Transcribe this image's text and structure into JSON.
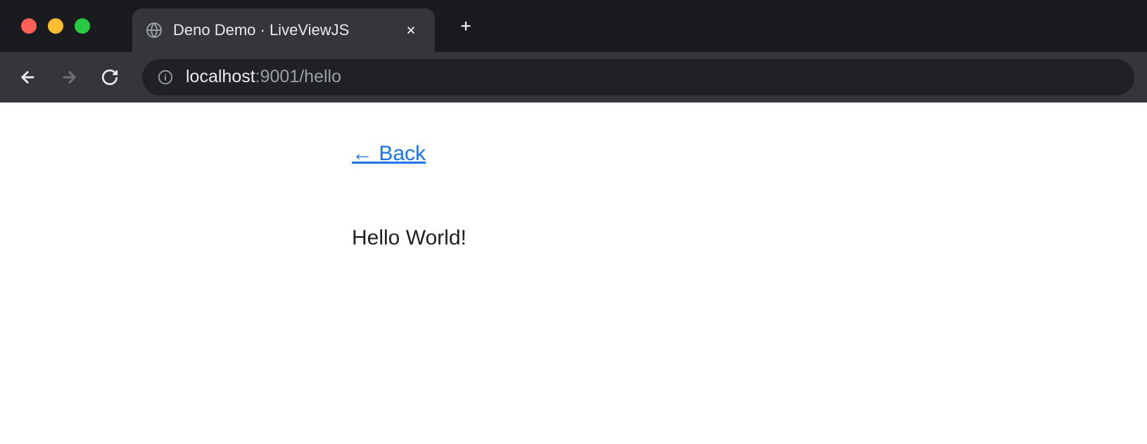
{
  "tab": {
    "title": "Deno Demo · LiveViewJS"
  },
  "url": {
    "host": "localhost",
    "port_path": ":9001/hello"
  },
  "page": {
    "back_link": "← Back",
    "body_text": "Hello World!"
  }
}
